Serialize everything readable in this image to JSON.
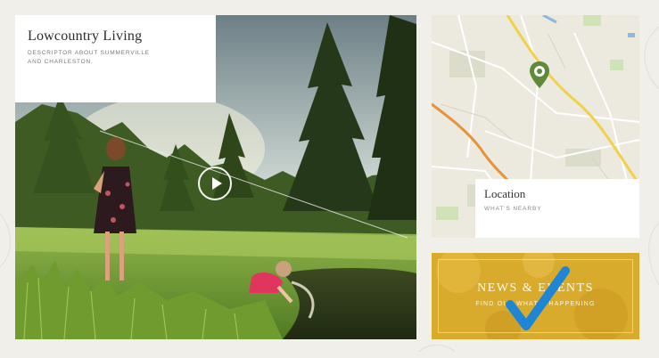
{
  "hero": {
    "title": "Lowcountry Living",
    "description": "DESCRIPTOR ABOUT SUMMERVILLE AND CHARLESTON."
  },
  "location": {
    "title": "Location",
    "subtitle": "WHAT'S NEARBY"
  },
  "news": {
    "title": "NEWS & EVENTS",
    "subtitle": "FIND OUT WHAT'S HAPPENING"
  },
  "icons": {
    "play": "play-icon",
    "map_pin": "map-pin-icon",
    "checkmark": "checkmark-icon"
  },
  "colors": {
    "page_background": "#f1efea",
    "news_background": "#d9ab2c",
    "pin_green": "#5f8a3a",
    "checkmark_blue": "#1f86d6"
  }
}
